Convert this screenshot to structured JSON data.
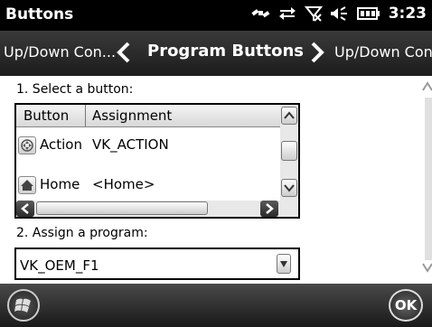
{
  "statusbar": {
    "title": "Buttons",
    "time": "3:23",
    "icons": [
      "satellite-icon",
      "data-sync-icon",
      "no-signal-icon",
      "volume-icon",
      "battery-icon"
    ]
  },
  "pivot": {
    "prev": "Up/Down Con...",
    "current": "Program Buttons",
    "next": "Up/Down Con..."
  },
  "form": {
    "select_label": "1. Select a button:",
    "grid": {
      "columns": [
        "Button",
        "Assignment"
      ],
      "rows": [
        {
          "button": "Action",
          "assignment": "VK_ACTION",
          "icon": "action-icon"
        },
        {
          "button": "Home",
          "assignment": "<Home>",
          "icon": "home-icon"
        }
      ]
    },
    "assign_label": "2. Assign a program:",
    "program_value": "VK_OEM_F1"
  },
  "softkeys": {
    "ok": "OK",
    "start_icon": "windows-start-icon"
  },
  "colors": {
    "statusbar_bg": "#000000",
    "pivot_bg": "#2a2a2a",
    "content_bg": "#ffffff"
  }
}
